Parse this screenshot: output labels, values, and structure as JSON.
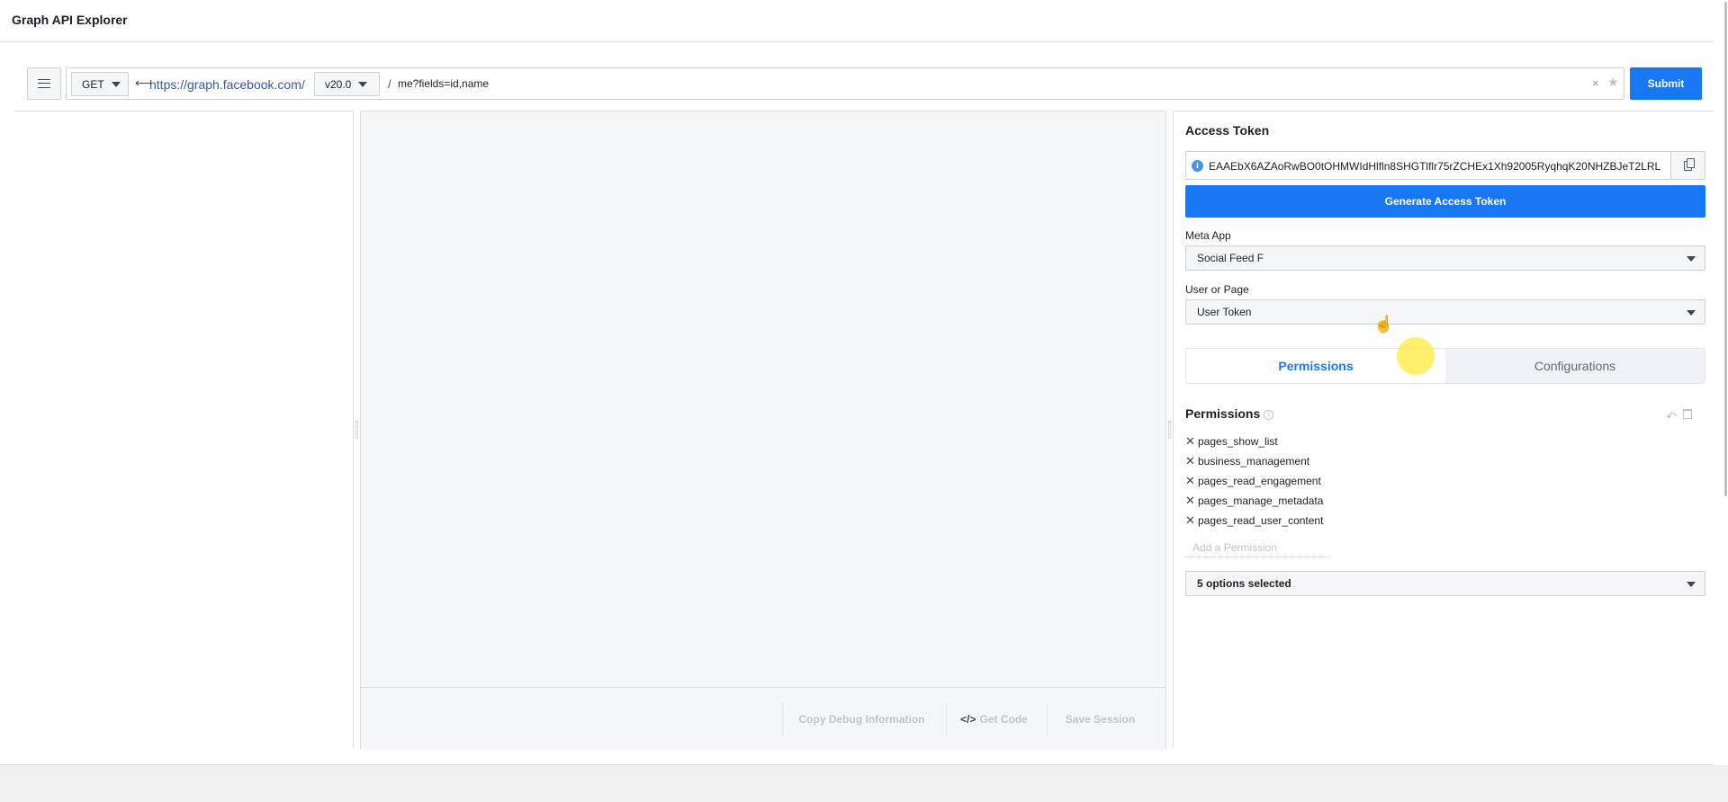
{
  "app": {
    "title": "Graph API Explorer"
  },
  "query": {
    "method": "GET",
    "base_url": "https://graph.facebook.com/",
    "version": "v20.0",
    "separator": "/",
    "path": "me?fields=id,name",
    "arrow": "⟵",
    "clear": "×",
    "star": "★"
  },
  "toolbar": {
    "submit_label": "Submit"
  },
  "footer": {
    "copy_debug_label": "Copy Debug Information",
    "get_code_label": "Get Code",
    "get_code_icon": "</>",
    "save_session_label": "Save Session"
  },
  "access_token": {
    "heading": "Access Token",
    "info_glyph": "i",
    "value": "EAAEbX6AZAoRwBO0tOHMWIdHlfln8SHGTlflr75rZCHEx1Xh92005RyqhqK20NHZBJeT2LRL",
    "generate_label": "Generate Access Token"
  },
  "meta_app": {
    "label": "Meta App",
    "selected": "Social Feed F"
  },
  "user_or_page": {
    "label": "User or Page",
    "selected": "User Token"
  },
  "tabs": [
    {
      "label": "Permissions",
      "active": true
    },
    {
      "label": "Configurations",
      "active": false
    }
  ],
  "permissions": {
    "heading": "Permissions",
    "info_glyph": "i",
    "remove_glyph": "✕",
    "undo_glyph": "↶",
    "items": [
      "pages_show_list",
      "business_management",
      "pages_read_engagement",
      "pages_manage_metadata",
      "pages_read_user_content"
    ],
    "add_placeholder": "Add a Permission",
    "options_selected": "5 options selected"
  },
  "cursor": {
    "hand_glyph": "☝"
  },
  "colors": {
    "accent": "#1877f2",
    "link": "#385898",
    "highlight": "#ffeb3b"
  }
}
